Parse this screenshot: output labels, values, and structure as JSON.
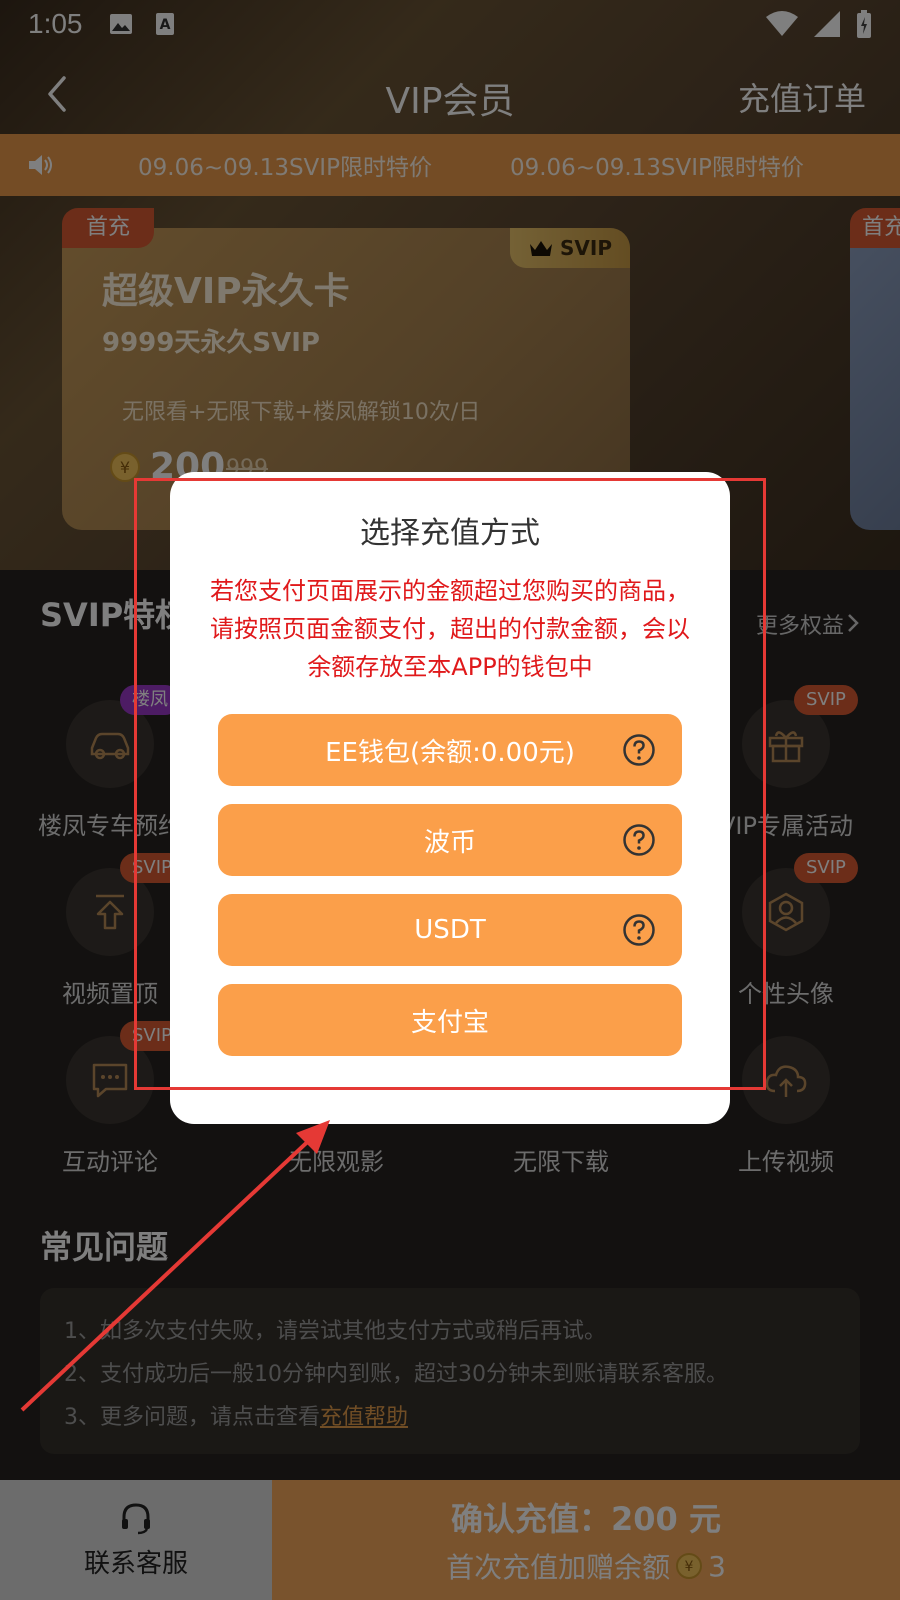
{
  "status_bar": {
    "time": "1:05"
  },
  "nav": {
    "title": "VIP会员",
    "right_link": "充值订单"
  },
  "marquee": {
    "messages": [
      "09.06~09.13SVIP限时特价",
      "09.06~09.13SVIP限时特价"
    ]
  },
  "card": {
    "tag": "首充",
    "badge": "SVIP",
    "title": "超级VIP永久卡",
    "subtitle": "9999天永久SVIP",
    "desc": "无限看+无限下载+楼凤解锁10次/日",
    "price": "200",
    "original_price": "999"
  },
  "card2": {
    "tag": "首充"
  },
  "privileges": {
    "title": "SVIP特权",
    "more": "更多权益",
    "items": [
      {
        "label": "楼凤专车预约",
        "badge": "楼凤"
      },
      {
        "label": "VIP专属活动",
        "badge": "SVIP"
      },
      {
        "label": "视频置顶",
        "badge": "SVIP"
      },
      {
        "label": "个性头像",
        "badge": "SVIP"
      },
      {
        "label": "互动评论",
        "badge": "SVIP"
      },
      {
        "label": "无限观影"
      },
      {
        "label": "无限下载"
      },
      {
        "label": "上传视频"
      }
    ]
  },
  "faq": {
    "title": "常见问题",
    "lines": [
      "1、如多次支付失败，请尝试其他支付方式或稍后再试。",
      "2、支付成功后一般10分钟内到账，超过30分钟未到账请联系客服。",
      "3、更多问题，请点击查看"
    ],
    "help_link": "充值帮助"
  },
  "bottom": {
    "contact": "联系客服",
    "confirm": "确认充值：200 元",
    "bonus": "首次充值加赠余额",
    "bonus_amount": "3"
  },
  "modal": {
    "title": "选择充值方式",
    "notice": "若您支付页面展示的金额超过您购买的商品，请按照页面金额支付，超出的付款金额，会以余额存放至本APP的钱包中",
    "options": [
      {
        "label": "EE钱包(余额:0.00元)",
        "help": true
      },
      {
        "label": "波币",
        "help": true
      },
      {
        "label": "USDT",
        "help": true
      },
      {
        "label": "支付宝",
        "help": false
      }
    ]
  },
  "colors": {
    "accent": "#fb9f4a",
    "notice_red": "#e0191b",
    "marquee": "#e8994a",
    "annotation": "#e53935"
  }
}
